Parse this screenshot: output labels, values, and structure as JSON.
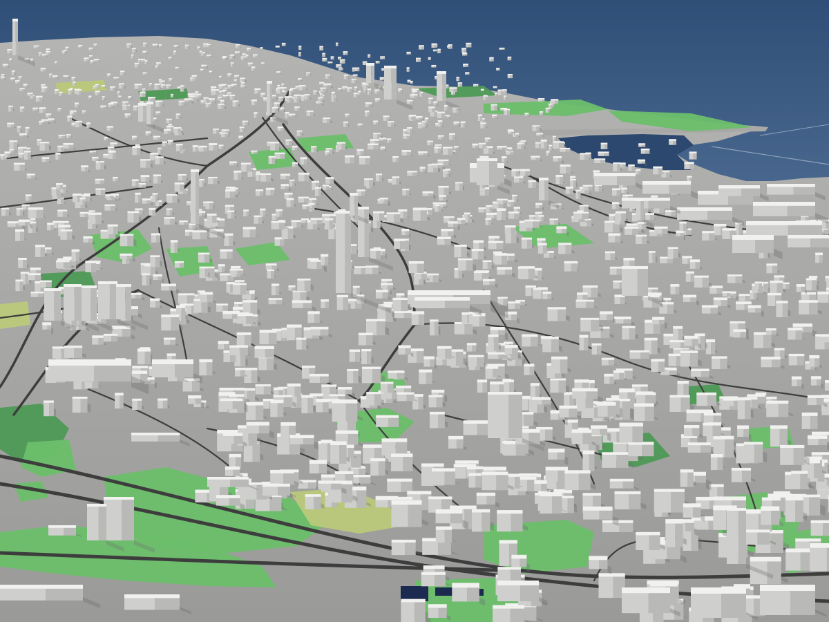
{
  "scene": {
    "kind": "3d-city-model-render",
    "view": "oblique-aerial",
    "features": [
      "sea",
      "harbor-basin",
      "pier",
      "high-rise-towers",
      "low-rise-blocks",
      "parks",
      "road-network",
      "highway-interchange",
      "solar-panels"
    ]
  },
  "colors": {
    "sea_far": "#34557e",
    "sea_near": "#46648b",
    "harbor": "#2e4a70",
    "ground": "#a3a3a2",
    "ground_near": "#9c9c9b",
    "road": "#3d3d3d",
    "park": "#6cbf6a",
    "park_dark": "#4e9a55",
    "field": "#b9c97a",
    "building_top": "#f1f1ef",
    "building_left": "#cfcfcd",
    "building_right": "#b9b9b7",
    "shadow": "#6e6e6d",
    "solar": "#1c2a4f"
  }
}
